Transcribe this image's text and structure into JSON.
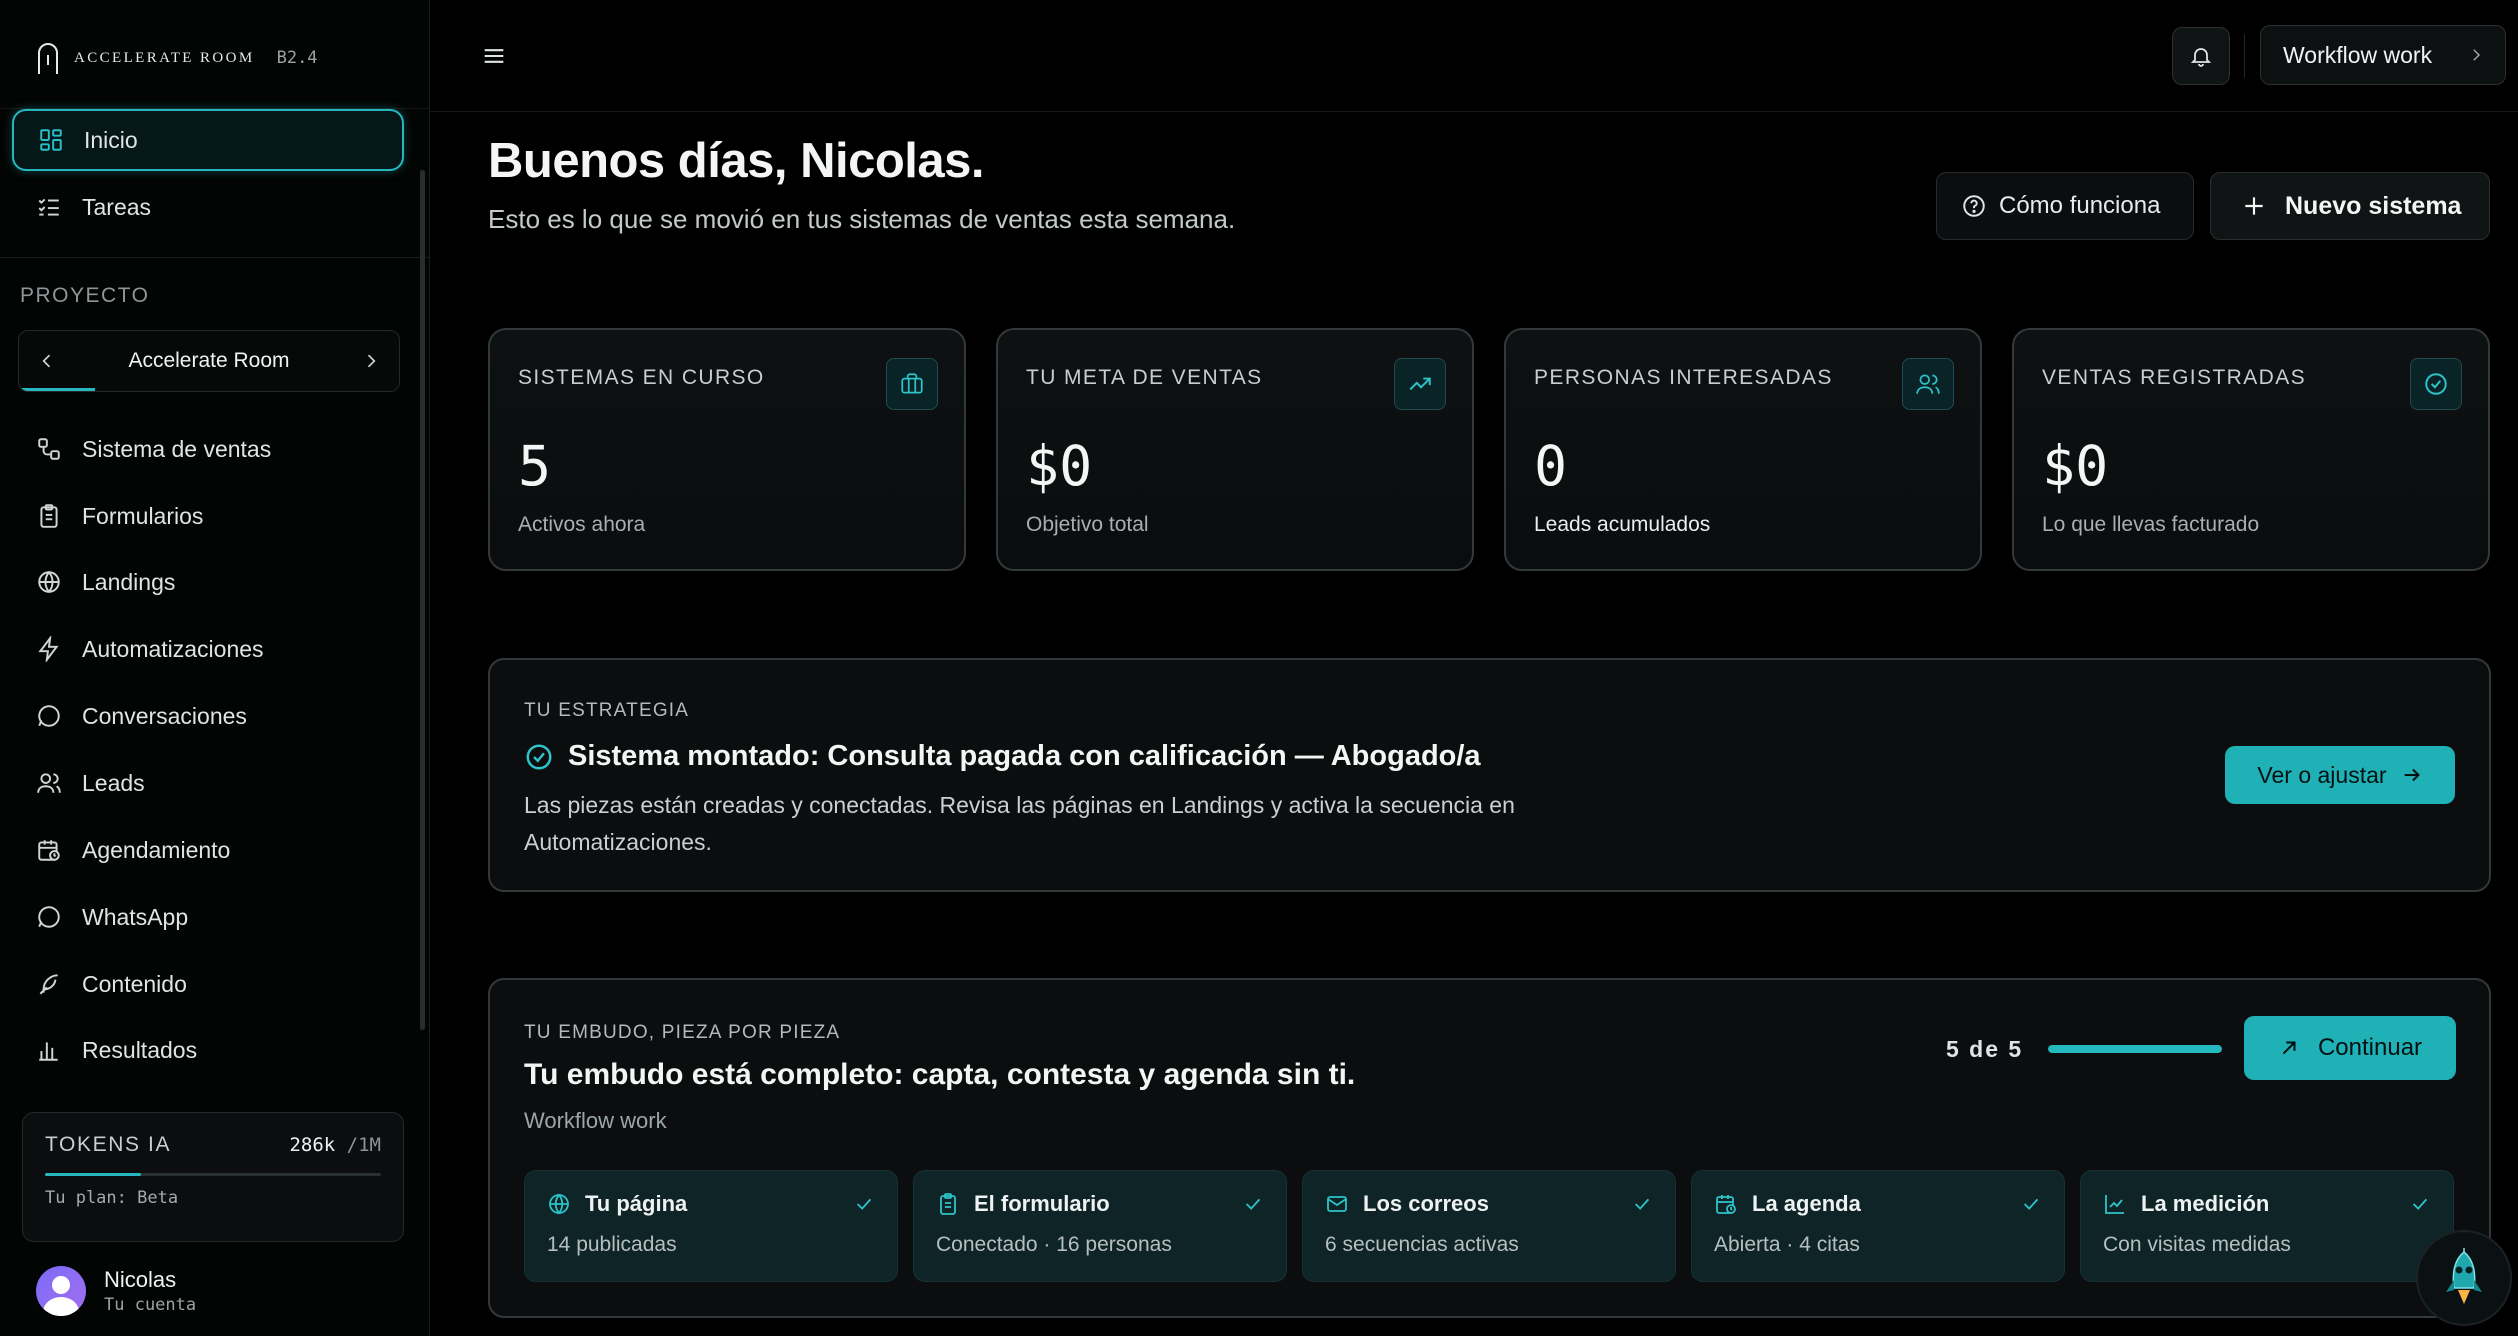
{
  "brand": {
    "name": "Accelerate Room",
    "version": "B2.4"
  },
  "sidebar": {
    "top_items": [
      {
        "label": "Inicio",
        "icon": "dashboard-icon",
        "active": true
      },
      {
        "label": "Tareas",
        "icon": "list-checks-icon"
      }
    ],
    "section_label": "PROYECTO",
    "project_name": "Accelerate Room",
    "items": [
      {
        "label": "Sistema de ventas",
        "icon": "workflow-icon"
      },
      {
        "label": "Formularios",
        "icon": "clipboard-icon"
      },
      {
        "label": "Landings",
        "icon": "globe-icon"
      },
      {
        "label": "Automatizaciones",
        "icon": "lightning-icon"
      },
      {
        "label": "Conversaciones",
        "icon": "chat-bubble-icon"
      },
      {
        "label": "Leads",
        "icon": "users-icon"
      },
      {
        "label": "Agendamiento",
        "icon": "calendar-clock-icon"
      },
      {
        "label": "WhatsApp",
        "icon": "whatsapp-icon"
      },
      {
        "label": "Contenido",
        "icon": "feather-icon"
      },
      {
        "label": "Resultados",
        "icon": "bar-chart-icon"
      }
    ],
    "tokens": {
      "label": "TOKENS IA",
      "used": "286k",
      "limit": "/1M",
      "used_fraction": 0.286,
      "plan": "Tu plan: Beta"
    },
    "user": {
      "name": "Nicolas",
      "subtitle": "Tu cuenta"
    }
  },
  "topbar": {
    "workflow_label": "Workflow work"
  },
  "header": {
    "greeting": "Buenos días, Nicolas.",
    "subtitle": "Esto es lo que se movió en tus sistemas de ventas esta semana.",
    "how_label": "Cómo funciona",
    "new_label": "Nuevo sistema"
  },
  "stats": [
    {
      "label": "SISTEMAS EN CURSO",
      "value": "5",
      "sub": "Activos ahora",
      "icon": "briefcase-icon"
    },
    {
      "label": "TU META DE VENTAS",
      "value": "$0",
      "sub": "Objetivo total",
      "icon": "trending-up-icon"
    },
    {
      "label": "PERSONAS INTERESADAS",
      "value": "0",
      "sub": "Leads acumulados",
      "icon": "users-icon"
    },
    {
      "label": "VENTAS REGISTRADAS",
      "value": "$0",
      "sub": "Lo que llevas facturado",
      "icon": "check-circle-icon"
    }
  ],
  "strategy": {
    "kicker": "TU ESTRATEGIA",
    "title": "Sistema montado: Consulta pagada con calificación — Abogado/a",
    "description": "Las piezas están creadas y conectadas. Revisa las páginas en Landings y activa la secuencia en Automatizaciones.",
    "button": "Ver o ajustar"
  },
  "funnel": {
    "kicker": "TU EMBUDO, PIEZA POR PIEZA",
    "title": "Tu embudo está completo: capta, contesta y agenda sin ti.",
    "project": "Workflow work",
    "progress_text": "5 de 5",
    "progress_fraction": 1.0,
    "button": "Continuar",
    "steps": [
      {
        "title": "Tu página",
        "sub": "14 publicadas",
        "icon": "globe-icon"
      },
      {
        "title": "El formulario",
        "sub": "Conectado · 16 personas",
        "icon": "clipboard-icon"
      },
      {
        "title": "Los correos",
        "sub": "6 secuencias activas",
        "icon": "mail-icon"
      },
      {
        "title": "La agenda",
        "sub": "Abierta · 4 citas",
        "icon": "calendar-clock-icon"
      },
      {
        "title": "La medición",
        "sub": "Con visitas medidas",
        "icon": "line-chart-icon"
      }
    ]
  },
  "colors": {
    "accent": "#20b1b6",
    "background": "#000000",
    "card": "#0b0d0e"
  }
}
